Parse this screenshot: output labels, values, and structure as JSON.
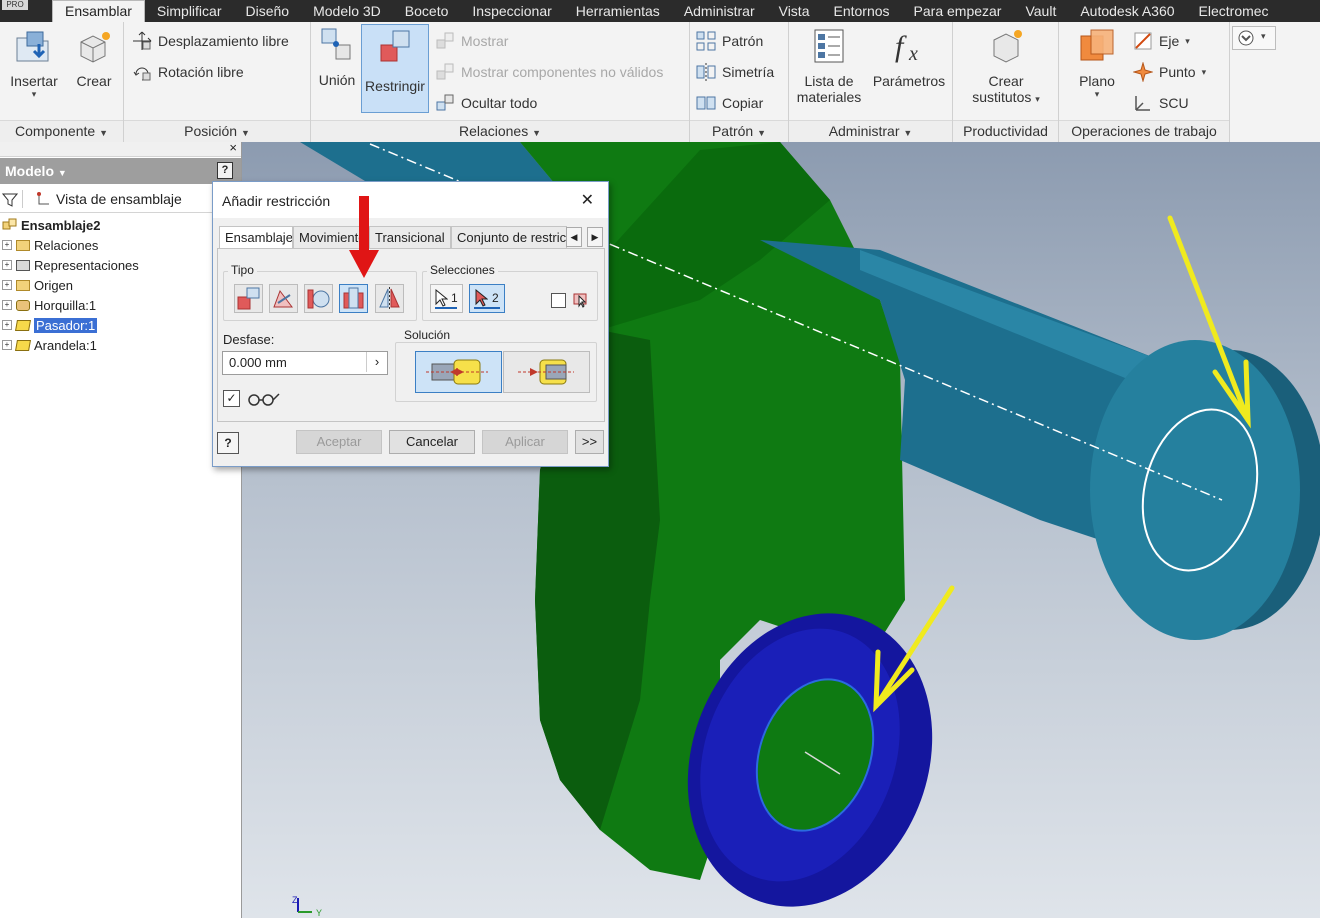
{
  "menubar": {
    "badge": "PRO",
    "tabs": [
      "Ensamblar",
      "Simplificar",
      "Diseño",
      "Modelo 3D",
      "Boceto",
      "Inspeccionar",
      "Herramientas",
      "Administrar",
      "Vista",
      "Entornos",
      "Para empezar",
      "Vault",
      "Autodesk A360",
      "Electromec"
    ],
    "active_tab": "Ensamblar"
  },
  "ribbon": {
    "componente": {
      "title": "Componente",
      "insertar": "Insertar",
      "crear": "Crear"
    },
    "posicion": {
      "title": "Posición",
      "desplazamiento": "Desplazamiento libre",
      "rotacion": "Rotación libre"
    },
    "relaciones": {
      "title": "Relaciones",
      "union": "Unión",
      "restringir": "Restringir",
      "mostrar": "Mostrar",
      "mostrar_no_validos": "Mostrar componentes no válidos",
      "ocultar_todo": "Ocultar todo"
    },
    "patron": {
      "title": "Patrón",
      "patron": "Patrón",
      "simetria": "Simetría",
      "copiar": "Copiar"
    },
    "administrar": {
      "title": "Administrar",
      "lista_1": "Lista de",
      "lista_2": "materiales",
      "parametros": "Parámetros"
    },
    "productividad": {
      "title": "Productividad",
      "crear_1": "Crear",
      "crear_2": "sustitutos"
    },
    "operaciones": {
      "title": "Operaciones de trabajo",
      "plano": "Plano",
      "eje": "Eje",
      "punto": "Punto",
      "scu": "SCU"
    }
  },
  "browser": {
    "title": "Modelo",
    "help": "?",
    "close": "×",
    "view_selector": "Vista de ensamblaje",
    "root": "Ensamblaje2",
    "items": [
      "Relaciones",
      "Representaciones",
      "Origen",
      "Horquilla:1",
      "Pasador:1",
      "Arandela:1"
    ],
    "selected": "Pasador:1"
  },
  "dialog": {
    "title": "Añadir restricción",
    "close": "✕",
    "tabs": [
      "Ensamblaje",
      "Movimiento",
      "Transicional",
      "Conjunto de restric"
    ],
    "active_tab": "Ensamblaje",
    "group_tipo": "Tipo",
    "group_selecciones": "Selecciones",
    "selection_1": "1",
    "selection_2": "2",
    "offset_label": "Desfase:",
    "offset_value": "0.000 mm",
    "solucion_label": "Solución",
    "help": "?",
    "btn_aceptar": "Aceptar",
    "btn_cancelar": "Cancelar",
    "btn_aplicar": "Aplicar",
    "btn_more": ">>",
    "preview_checked": true
  },
  "colors": {
    "menubar_bg": "#2b2b2b",
    "ribbon_bg": "#f3f3f3",
    "part_green": "#0f7a12",
    "part_teal": "#1d6f8e",
    "part_blue": "#14169e",
    "annotation_yellow": "#f0ea1e",
    "annotation_red": "#e01515"
  }
}
